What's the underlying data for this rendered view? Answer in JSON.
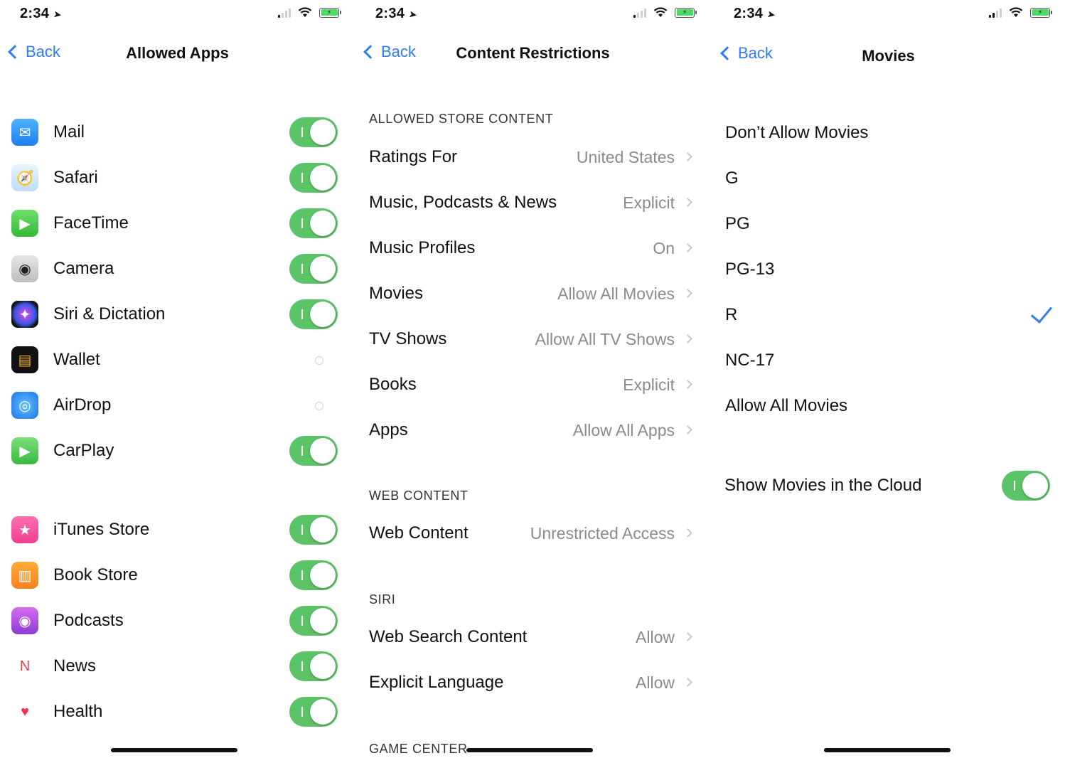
{
  "status_bar": {
    "time": "2:34"
  },
  "back_label": "Back",
  "colors": {
    "accent": "#2f7cf6",
    "toggle_on": "#5cc468"
  },
  "panel1": {
    "title": "Allowed Apps",
    "apps": [
      {
        "label": "Mail",
        "icon": "mail-icon",
        "on": true
      },
      {
        "label": "Safari",
        "icon": "safari-icon",
        "on": true
      },
      {
        "label": "FaceTime",
        "icon": "facetime-icon",
        "on": true
      },
      {
        "label": "Camera",
        "icon": "camera-icon",
        "on": true
      },
      {
        "label": "Siri & Dictation",
        "icon": "siri-icon",
        "on": true
      },
      {
        "label": "Wallet",
        "icon": "wallet-icon",
        "on": false
      },
      {
        "label": "AirDrop",
        "icon": "airdrop-icon",
        "on": false
      },
      {
        "label": "CarPlay",
        "icon": "carplay-icon",
        "on": true
      }
    ],
    "stores": [
      {
        "label": "iTunes Store",
        "icon": "itunes-store-icon",
        "on": true
      },
      {
        "label": "Book Store",
        "icon": "book-store-icon",
        "on": true
      },
      {
        "label": "Podcasts",
        "icon": "podcasts-icon",
        "on": true
      },
      {
        "label": "News",
        "icon": "news-icon",
        "on": true
      },
      {
        "label": "Health",
        "icon": "health-icon",
        "on": true
      }
    ]
  },
  "panel2": {
    "title": "Content Restrictions",
    "store_header": "ALLOWED STORE CONTENT",
    "store_rows": [
      {
        "label": "Ratings For",
        "value": "United States"
      },
      {
        "label": "Music, Podcasts & News",
        "value": "Explicit"
      },
      {
        "label": "Music Profiles",
        "value": "On"
      },
      {
        "label": "Movies",
        "value": "Allow All Movies"
      },
      {
        "label": "TV Shows",
        "value": "Allow All TV Shows"
      },
      {
        "label": "Books",
        "value": "Explicit"
      },
      {
        "label": "Apps",
        "value": "Allow All Apps"
      }
    ],
    "web_header": "WEB CONTENT",
    "web_rows": [
      {
        "label": "Web Content",
        "value": "Unrestricted Access"
      }
    ],
    "siri_header": "SIRI",
    "siri_rows": [
      {
        "label": "Web Search Content",
        "value": "Allow"
      },
      {
        "label": "Explicit Language",
        "value": "Allow"
      }
    ],
    "game_header": "GAME CENTER"
  },
  "panel3": {
    "title": "Movies",
    "options": [
      {
        "label": "Don’t Allow Movies",
        "selected": false
      },
      {
        "label": "G",
        "selected": false
      },
      {
        "label": "PG",
        "selected": false
      },
      {
        "label": "PG-13",
        "selected": false
      },
      {
        "label": "R",
        "selected": true
      },
      {
        "label": "NC-17",
        "selected": false
      },
      {
        "label": "Allow All Movies",
        "selected": false
      }
    ],
    "cloud_label": "Show Movies in the Cloud",
    "cloud_on": true
  }
}
